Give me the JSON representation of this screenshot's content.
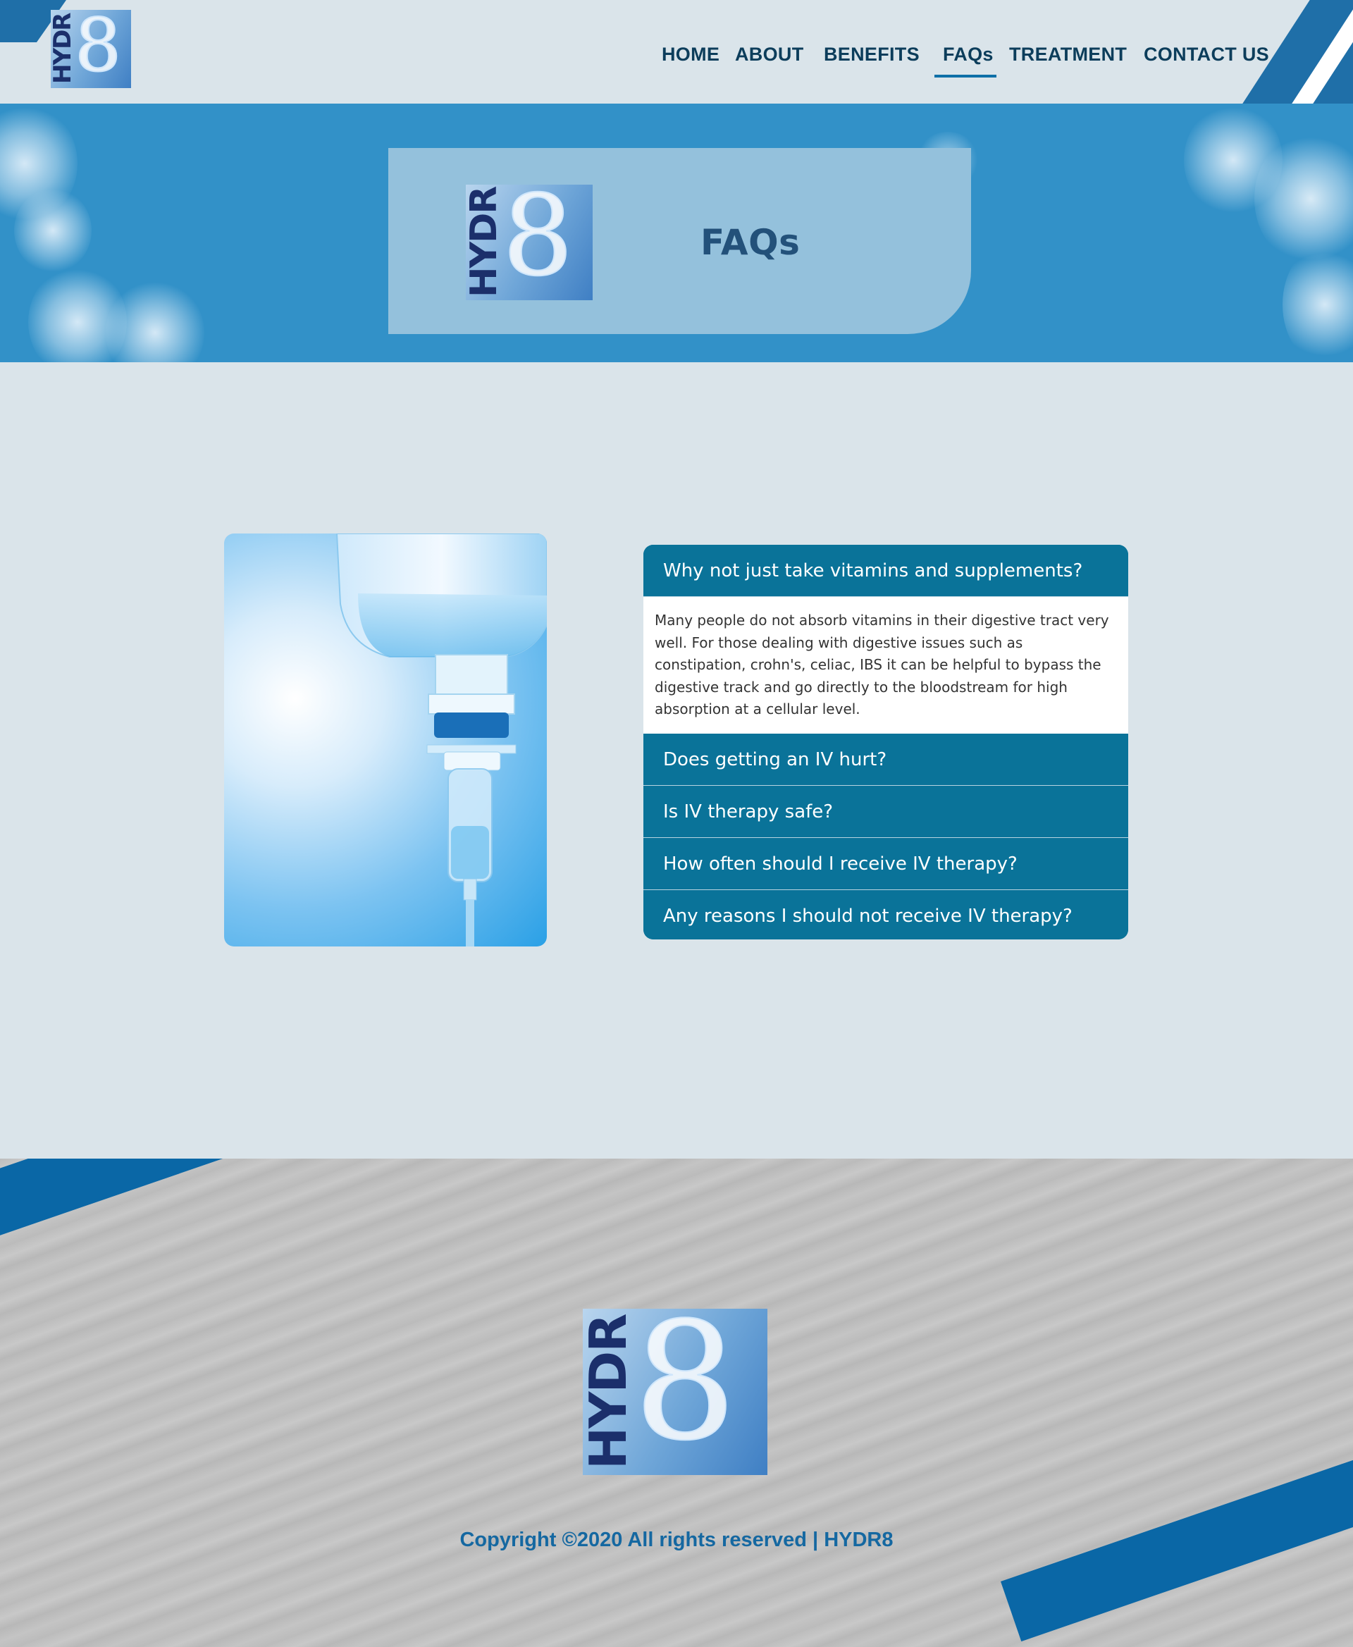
{
  "brand": {
    "logo_text": "HYDR",
    "logo_numeral": "8",
    "primary_color": "#0a7399",
    "accent_color": "#3291c8",
    "text_dark": "#0c3d5b"
  },
  "nav": {
    "items": [
      {
        "label": "HOME"
      },
      {
        "label": "ABOUT"
      },
      {
        "label": "BENEFITS"
      },
      {
        "label": "FAQs",
        "active": true
      },
      {
        "label": "TREATMENT"
      },
      {
        "label": "CONTACT US"
      }
    ]
  },
  "hero": {
    "title": "FAQs"
  },
  "faq": {
    "image": "iv-drip-bag",
    "items": [
      {
        "question": "Why not just take vitamins and supplements?",
        "answer": "Many people do not absorb vitamins in their digestive tract very well. For those dealing with digestive issues such as constipation, crohn's, celiac, IBS it can be helpful to bypass the digestive track and go directly to the bloodstream for high absorption at a cellular level.",
        "expanded": true
      },
      {
        "question": "Does getting an IV hurt?",
        "expanded": false
      },
      {
        "question": "Is IV therapy safe?",
        "expanded": false
      },
      {
        "question": "How often should I receive IV therapy?",
        "expanded": false
      },
      {
        "question": "Any reasons I should not receive IV therapy?",
        "expanded": false
      }
    ]
  },
  "footer": {
    "copyright": "Copyright ©2020 All rights reserved | HYDR8"
  }
}
